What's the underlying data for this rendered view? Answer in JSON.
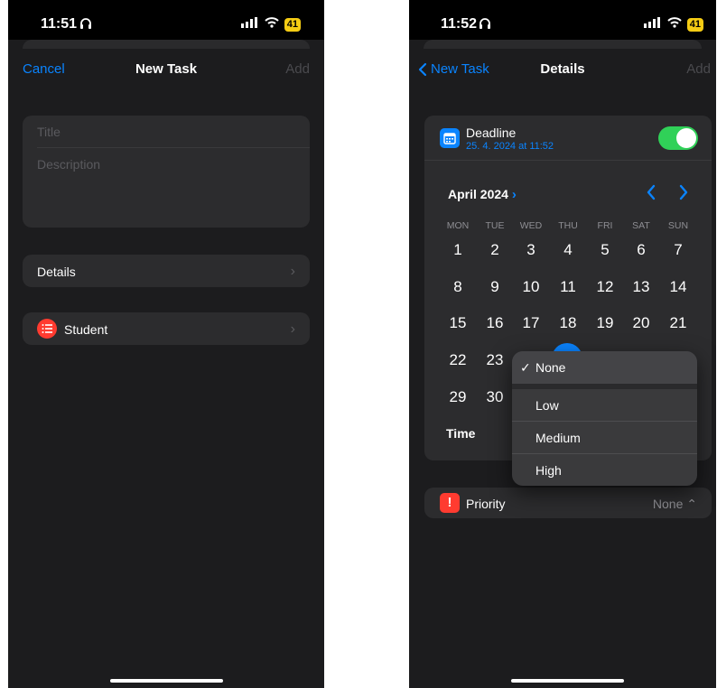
{
  "left": {
    "status": {
      "time": "11:51",
      "battery": "41"
    },
    "nav": {
      "cancel": "Cancel",
      "title": "New Task",
      "add": "Add"
    },
    "form": {
      "title_placeholder": "Title",
      "description_placeholder": "Description"
    },
    "details_label": "Details",
    "list_label": "Student"
  },
  "right": {
    "status": {
      "time": "11:52",
      "battery": "41"
    },
    "nav": {
      "back": "New Task",
      "title": "Details",
      "add": "Add"
    },
    "deadline": {
      "label": "Deadline",
      "value": "25. 4. 2024 at 11:52",
      "enabled": true
    },
    "calendar": {
      "month": "April 2024",
      "weekdays": [
        "MON",
        "TUE",
        "WED",
        "THU",
        "FRI",
        "SAT",
        "SUN"
      ],
      "weeks": [
        [
          "1",
          "2",
          "3",
          "4",
          "5",
          "6",
          "7"
        ],
        [
          "8",
          "9",
          "10",
          "11",
          "12",
          "13",
          "14"
        ],
        [
          "15",
          "16",
          "17",
          "18",
          "19",
          "20",
          "21"
        ],
        [
          "22",
          "23",
          "",
          "",
          "",
          "",
          ""
        ],
        [
          "29",
          "30",
          "",
          "",
          "",
          "",
          ""
        ]
      ]
    },
    "time_label": "Time",
    "priority_menu": {
      "items": [
        "None",
        "Low",
        "Medium",
        "High"
      ],
      "checkmark": "✓"
    },
    "priority": {
      "label": "Priority",
      "value": "None",
      "icon_glyph": "!"
    }
  },
  "colors": {
    "accent": "#0a84ff",
    "toggle_on": "#30d158",
    "list_icon": "#ff3b30",
    "priority_icon": "#ff3b30",
    "battery": "#f5cc14"
  }
}
